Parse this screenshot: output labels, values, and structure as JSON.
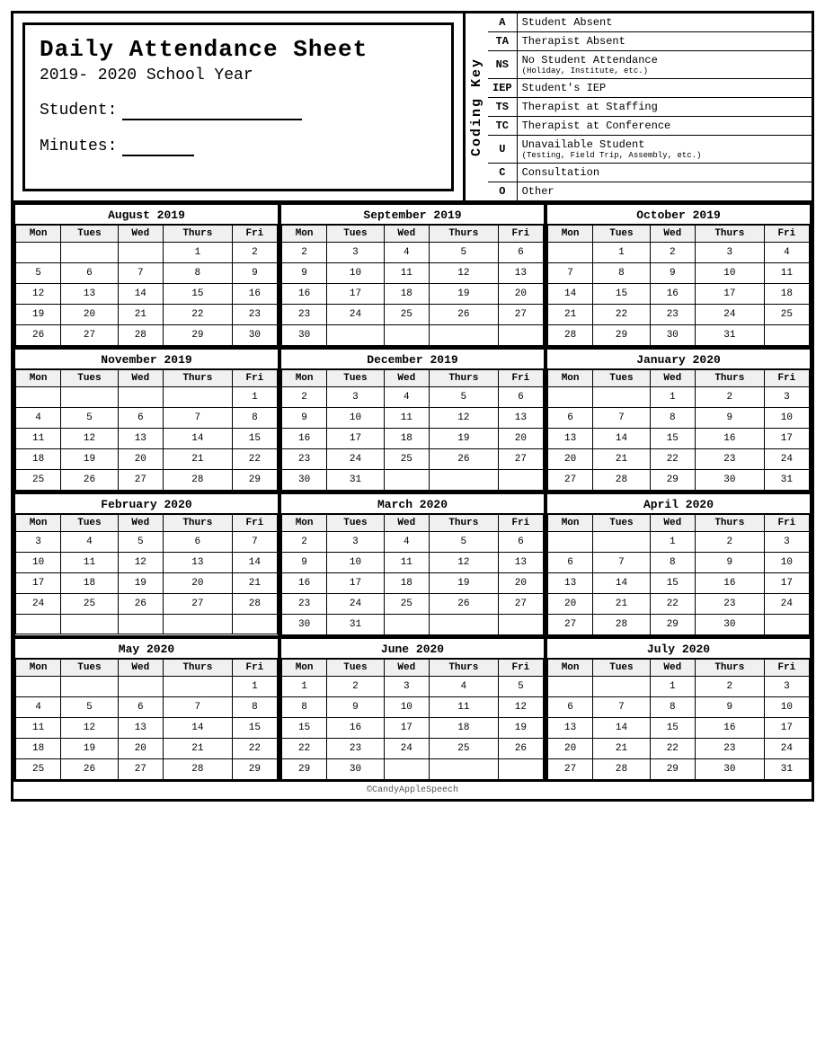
{
  "header": {
    "title": "Daily Attendance Sheet",
    "subtitle": "2019- 2020 School Year",
    "student_label": "Student:",
    "minutes_label": "Minutes:"
  },
  "coding_key_label": "Coding Key",
  "coding_key": [
    {
      "code": "A",
      "description": "Student Absent",
      "sub": ""
    },
    {
      "code": "TA",
      "description": "Therapist Absent",
      "sub": ""
    },
    {
      "code": "NS",
      "description": "No Student Attendance",
      "sub": "(Holiday, Institute, etc.)"
    },
    {
      "code": "IEP",
      "description": "Student's IEP",
      "sub": ""
    },
    {
      "code": "TS",
      "description": "Therapist at Staffing",
      "sub": ""
    },
    {
      "code": "TC",
      "description": "Therapist at Conference",
      "sub": ""
    },
    {
      "code": "U",
      "description": "Unavailable Student",
      "sub": "(Testing, Field Trip, Assembly, etc.)"
    },
    {
      "code": "C",
      "description": "Consultation",
      "sub": ""
    },
    {
      "code": "O",
      "description": "Other",
      "sub": ""
    }
  ],
  "calendars": [
    {
      "title": "August 2019",
      "headers": [
        "Mon",
        "Tues",
        "Wed",
        "Thurs",
        "Fri"
      ],
      "rows": [
        [
          "",
          "",
          "",
          "1",
          "2"
        ],
        [
          "5",
          "6",
          "7",
          "8",
          "9"
        ],
        [
          "12",
          "13",
          "14",
          "15",
          "16"
        ],
        [
          "19",
          "20",
          "21",
          "22",
          "23"
        ],
        [
          "26",
          "27",
          "28",
          "29",
          "30"
        ]
      ]
    },
    {
      "title": "September 2019",
      "headers": [
        "Mon",
        "Tues",
        "Wed",
        "Thurs",
        "Fri"
      ],
      "rows": [
        [
          "2",
          "3",
          "4",
          "5",
          "6"
        ],
        [
          "9",
          "10",
          "11",
          "12",
          "13"
        ],
        [
          "16",
          "17",
          "18",
          "19",
          "20"
        ],
        [
          "23",
          "24",
          "25",
          "26",
          "27"
        ],
        [
          "30",
          "",
          "",
          "",
          ""
        ]
      ]
    },
    {
      "title": "October 2019",
      "headers": [
        "Mon",
        "Tues",
        "Wed",
        "Thurs",
        "Fri"
      ],
      "rows": [
        [
          "",
          "1",
          "2",
          "3",
          "4"
        ],
        [
          "7",
          "8",
          "9",
          "10",
          "11"
        ],
        [
          "14",
          "15",
          "16",
          "17",
          "18"
        ],
        [
          "21",
          "22",
          "23",
          "24",
          "25"
        ],
        [
          "28",
          "29",
          "30",
          "31",
          ""
        ]
      ]
    },
    {
      "title": "November 2019",
      "headers": [
        "Mon",
        "Tues",
        "Wed",
        "Thurs",
        "Fri"
      ],
      "rows": [
        [
          "",
          "",
          "",
          "",
          "1"
        ],
        [
          "4",
          "5",
          "6",
          "7",
          "8"
        ],
        [
          "11",
          "12",
          "13",
          "14",
          "15"
        ],
        [
          "18",
          "19",
          "20",
          "21",
          "22"
        ],
        [
          "25",
          "26",
          "27",
          "28",
          "29"
        ]
      ]
    },
    {
      "title": "December 2019",
      "headers": [
        "Mon",
        "Tues",
        "Wed",
        "Thurs",
        "Fri"
      ],
      "rows": [
        [
          "2",
          "3",
          "4",
          "5",
          "6"
        ],
        [
          "9",
          "10",
          "11",
          "12",
          "13"
        ],
        [
          "16",
          "17",
          "18",
          "19",
          "20"
        ],
        [
          "23",
          "24",
          "25",
          "26",
          "27"
        ],
        [
          "30",
          "31",
          "",
          "",
          ""
        ]
      ]
    },
    {
      "title": "January 2020",
      "headers": [
        "Mon",
        "Tues",
        "Wed",
        "Thurs",
        "Fri"
      ],
      "rows": [
        [
          "",
          "",
          "1",
          "2",
          "3"
        ],
        [
          "6",
          "7",
          "8",
          "9",
          "10"
        ],
        [
          "13",
          "14",
          "15",
          "16",
          "17"
        ],
        [
          "20",
          "21",
          "22",
          "23",
          "24"
        ],
        [
          "27",
          "28",
          "29",
          "30",
          "31"
        ]
      ]
    },
    {
      "title": "February 2020",
      "headers": [
        "Mon",
        "Tues",
        "Wed",
        "Thurs",
        "Fri"
      ],
      "rows": [
        [
          "3",
          "4",
          "5",
          "6",
          "7"
        ],
        [
          "10",
          "11",
          "12",
          "13",
          "14"
        ],
        [
          "17",
          "18",
          "19",
          "20",
          "21"
        ],
        [
          "24",
          "25",
          "26",
          "27",
          "28"
        ],
        [
          "",
          "",
          "",
          "",
          ""
        ]
      ]
    },
    {
      "title": "March 2020",
      "headers": [
        "Mon",
        "Tues",
        "Wed",
        "Thurs",
        "Fri"
      ],
      "rows": [
        [
          "2",
          "3",
          "4",
          "5",
          "6"
        ],
        [
          "9",
          "10",
          "11",
          "12",
          "13"
        ],
        [
          "16",
          "17",
          "18",
          "19",
          "20"
        ],
        [
          "23",
          "24",
          "25",
          "26",
          "27"
        ],
        [
          "30",
          "31",
          "",
          "",
          ""
        ]
      ]
    },
    {
      "title": "April 2020",
      "headers": [
        "Mon",
        "Tues",
        "Wed",
        "Thurs",
        "Fri"
      ],
      "rows": [
        [
          "",
          "",
          "1",
          "2",
          "3"
        ],
        [
          "6",
          "7",
          "8",
          "9",
          "10"
        ],
        [
          "13",
          "14",
          "15",
          "16",
          "17"
        ],
        [
          "20",
          "21",
          "22",
          "23",
          "24"
        ],
        [
          "27",
          "28",
          "29",
          "30",
          ""
        ]
      ]
    },
    {
      "title": "May 2020",
      "headers": [
        "Mon",
        "Tues",
        "Wed",
        "Thurs",
        "Fri"
      ],
      "rows": [
        [
          "",
          "",
          "",
          "",
          "1"
        ],
        [
          "4",
          "5",
          "6",
          "7",
          "8"
        ],
        [
          "11",
          "12",
          "13",
          "14",
          "15"
        ],
        [
          "18",
          "19",
          "20",
          "21",
          "22"
        ],
        [
          "25",
          "26",
          "27",
          "28",
          "29"
        ]
      ]
    },
    {
      "title": "June 2020",
      "headers": [
        "Mon",
        "Tues",
        "Wed",
        "Thurs",
        "Fri"
      ],
      "rows": [
        [
          "1",
          "2",
          "3",
          "4",
          "5"
        ],
        [
          "8",
          "9",
          "10",
          "11",
          "12"
        ],
        [
          "15",
          "16",
          "17",
          "18",
          "19"
        ],
        [
          "22",
          "23",
          "24",
          "25",
          "26"
        ],
        [
          "29",
          "30",
          "",
          "",
          ""
        ]
      ]
    },
    {
      "title": "July 2020",
      "headers": [
        "Mon",
        "Tues",
        "Wed",
        "Thurs",
        "Fri"
      ],
      "rows": [
        [
          "",
          "",
          "1",
          "2",
          "3"
        ],
        [
          "6",
          "7",
          "8",
          "9",
          "10"
        ],
        [
          "13",
          "14",
          "15",
          "16",
          "17"
        ],
        [
          "20",
          "21",
          "22",
          "23",
          "24"
        ],
        [
          "27",
          "28",
          "29",
          "30",
          "31"
        ]
      ]
    }
  ],
  "footer": "©CandyAppleSpeech"
}
